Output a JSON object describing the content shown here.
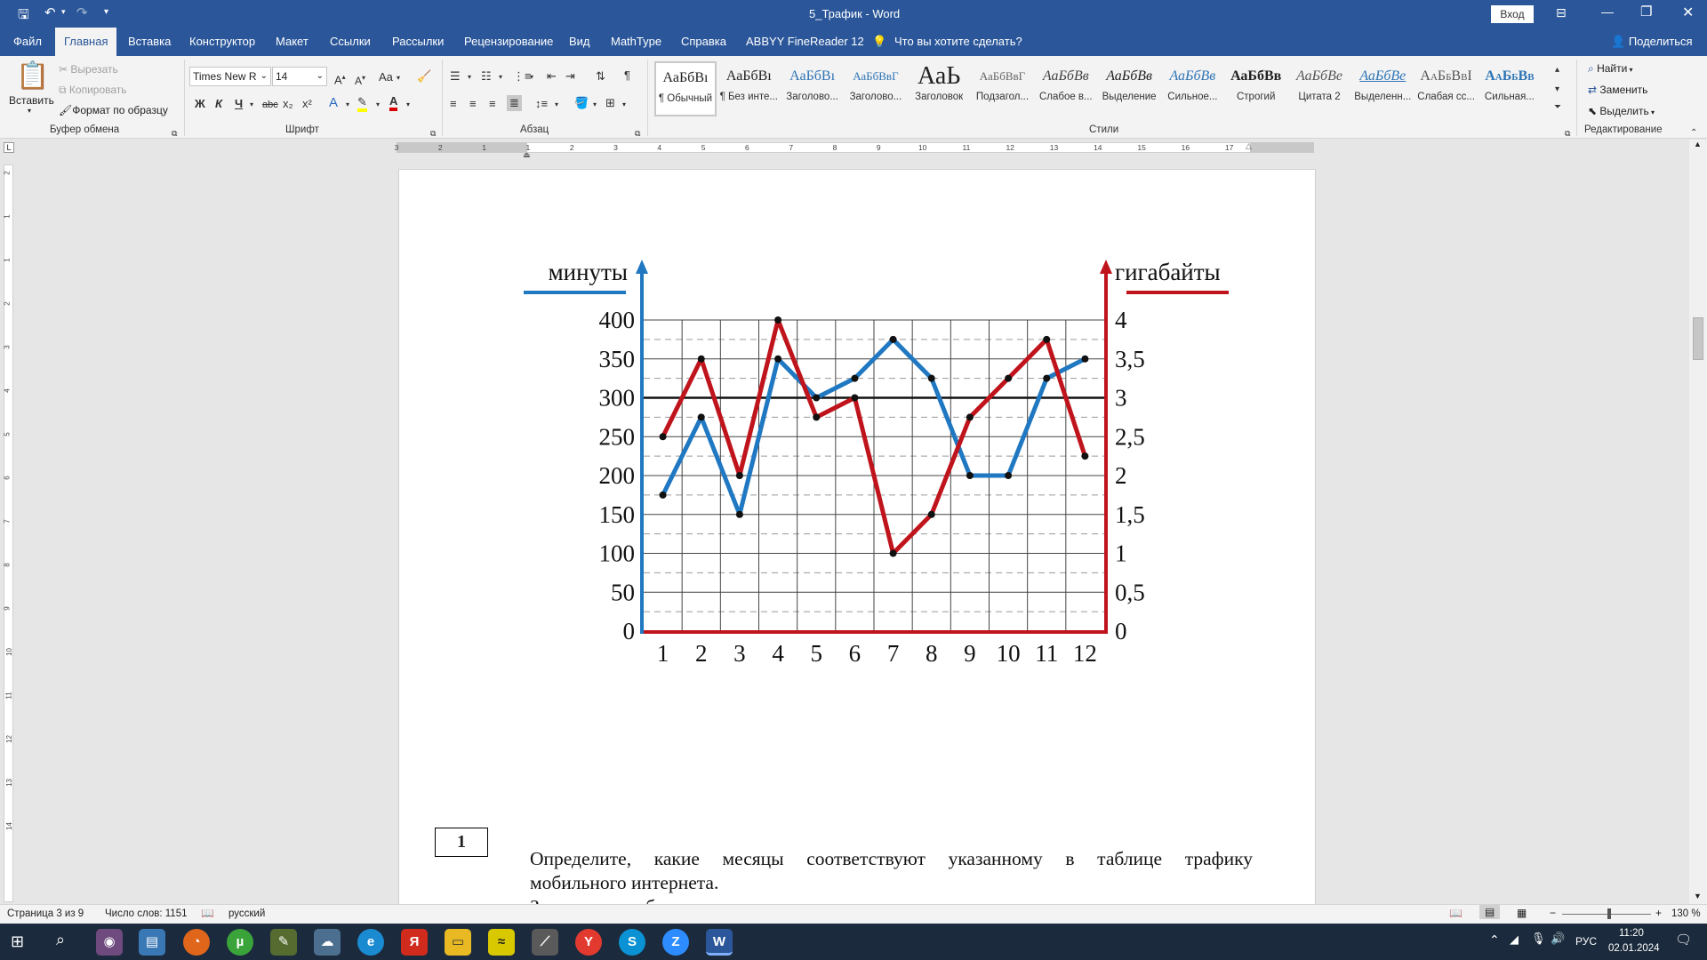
{
  "titlebar": {
    "doc_title": "5_Трафик  -  Word",
    "signin": "Вход"
  },
  "tabs": [
    {
      "label": "Файл",
      "active": false
    },
    {
      "label": "Главная",
      "active": true
    },
    {
      "label": "Вставка",
      "active": false
    },
    {
      "label": "Конструктор",
      "active": false
    },
    {
      "label": "Макет",
      "active": false
    },
    {
      "label": "Ссылки",
      "active": false
    },
    {
      "label": "Рассылки",
      "active": false
    },
    {
      "label": "Рецензирование",
      "active": false
    },
    {
      "label": "Вид",
      "active": false
    },
    {
      "label": "MathType",
      "active": false
    },
    {
      "label": "Справка",
      "active": false
    },
    {
      "label": "ABBYY FineReader 12",
      "active": false
    }
  ],
  "tell_me": "Что вы хотите сделать?",
  "share": "Поделиться",
  "clipboard": {
    "paste": "Вставить",
    "cut": "Вырезать",
    "copy": "Копировать",
    "format_painter": "Формат по образцу",
    "group": "Буфер обмена"
  },
  "font": {
    "name": "Times New R",
    "size": "14",
    "group": "Шрифт",
    "bold": "Ж",
    "italic": "К",
    "underline": "Ч",
    "strike": "abc",
    "sub": "x₂",
    "sup": "x²",
    "case": "Aa"
  },
  "paragraph": {
    "group": "Абзац"
  },
  "styles": {
    "group": "Стили",
    "items": [
      {
        "preview": "АаБбВı",
        "name": "¶ Обычный"
      },
      {
        "preview": "АаБбВı",
        "name": "¶ Без инте..."
      },
      {
        "preview": "АаБбВı",
        "name": "Заголово..."
      },
      {
        "preview": "АаБбВвГ",
        "name": "Заголово..."
      },
      {
        "preview": "АаЬ",
        "name": "Заголовок"
      },
      {
        "preview": "АаБбВвГ",
        "name": "Подзагол..."
      },
      {
        "preview": "АаБбВв",
        "name": "Слабое в..."
      },
      {
        "preview": "АаБбВв",
        "name": "Выделение"
      },
      {
        "preview": "АаБбВв",
        "name": "Сильное..."
      },
      {
        "preview": "АаБбВв",
        "name": "Строгий"
      },
      {
        "preview": "АаБбВе",
        "name": "Цитата 2"
      },
      {
        "preview": "АаБбВе",
        "name": "Выделенн..."
      },
      {
        "preview": "АаБбВвІ",
        "name": "Слабая сс..."
      },
      {
        "preview": "АаБбВв",
        "name": "Сильная..."
      }
    ]
  },
  "editing": {
    "find": "Найти",
    "replace": "Заменить",
    "select": "Выделить",
    "group": "Редактирование"
  },
  "ruler_numbers": [
    "3",
    "2",
    "1",
    "1",
    "2",
    "3",
    "4",
    "5",
    "6",
    "7",
    "8",
    "9",
    "10",
    "11",
    "12",
    "13",
    "14",
    "15",
    "16",
    "17"
  ],
  "vruler_numbers": [
    "2",
    "1",
    "1",
    "2",
    "3",
    "4",
    "5",
    "6",
    "7",
    "8",
    "9",
    "10",
    "11",
    "12",
    "13",
    "14"
  ],
  "chart_data": {
    "type": "line",
    "left_axis_label": "минуты",
    "right_axis_label": "гигабайты",
    "x": [
      "1",
      "2",
      "3",
      "4",
      "5",
      "6",
      "7",
      "8",
      "9",
      "10",
      "11",
      "12"
    ],
    "left_ticks": [
      "0",
      "50",
      "100",
      "150",
      "200",
      "250",
      "300",
      "350",
      "400"
    ],
    "right_ticks": [
      "0",
      "0,5",
      "1",
      "1,5",
      "2",
      "2,5",
      "3",
      "3,5",
      "4"
    ],
    "ylim_left": [
      0,
      400
    ],
    "ylim_right": [
      0,
      4
    ],
    "threshold_minutes": 300,
    "series": [
      {
        "name": "минуты",
        "axis": "left",
        "color": "#1f78c1",
        "values": [
          175,
          275,
          150,
          350,
          300,
          325,
          375,
          325,
          200,
          200,
          325,
          350
        ]
      },
      {
        "name": "гигабайты",
        "axis": "right",
        "color": "#c0141c",
        "values": [
          2.5,
          3.5,
          2,
          4,
          2.75,
          3,
          1,
          1.5,
          2.75,
          3.25,
          3.75,
          2.25
        ]
      }
    ]
  },
  "task": {
    "number": "1",
    "line1": "Определите, какие месяцы соответствуют указанному в таблице трафику",
    "line2": "мобильного интернета.",
    "line3": "Запишите в таблицу в ответ"
  },
  "status": {
    "page": "Страница 3 из 9",
    "words": "Число слов: 1151",
    "lang": "русский",
    "zoom": "130 %"
  },
  "tray": {
    "lang": "РУС",
    "time": "11:20",
    "date": "02.01.2024"
  }
}
